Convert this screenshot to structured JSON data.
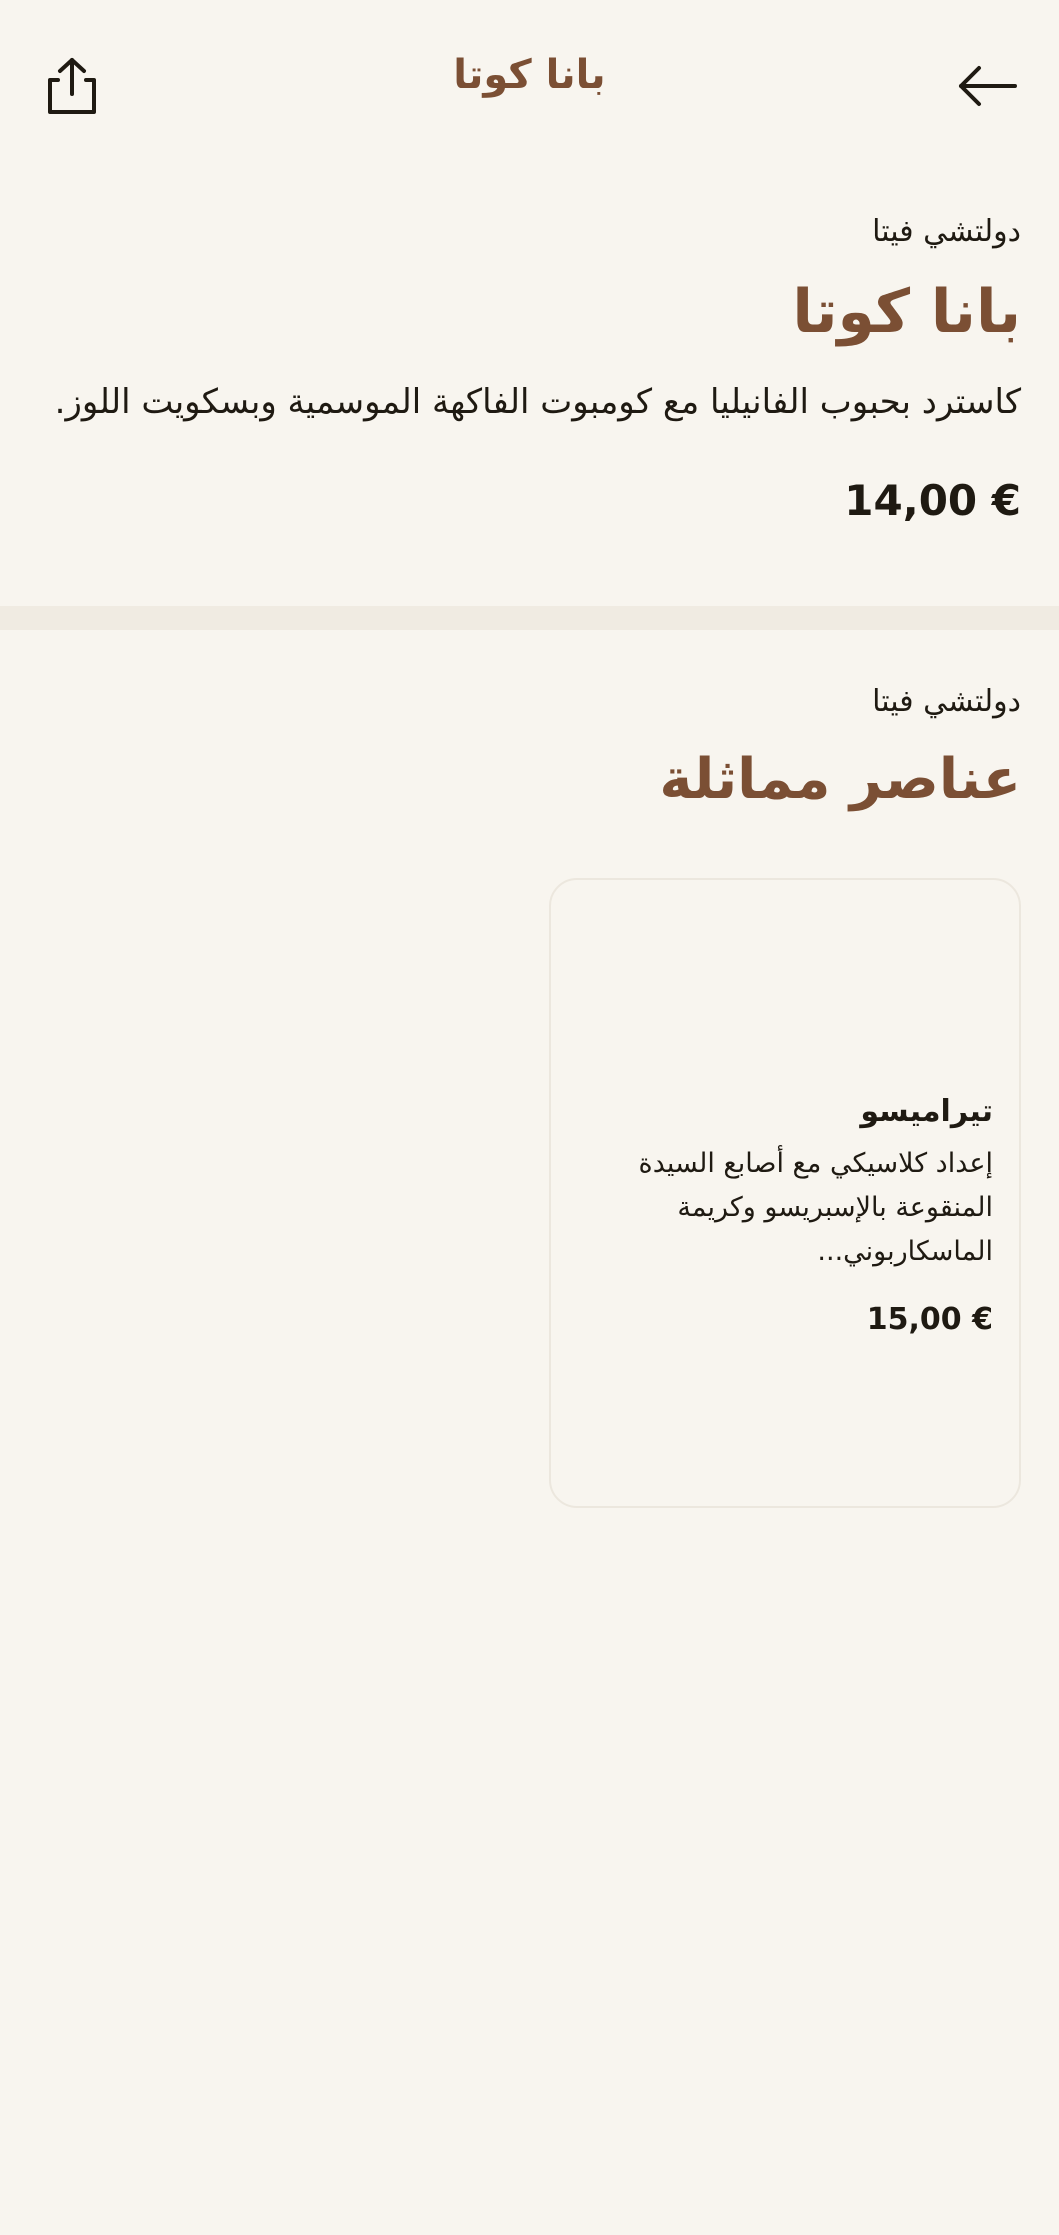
{
  "header": {
    "title": "بانا كوتا",
    "back_icon": "arrow-left-icon",
    "share_icon": "share-icon"
  },
  "product": {
    "category": "دولتشي فيتا",
    "title": "بانا كوتا",
    "description": "كاسترد بحبوب الفانيليا مع كومبوت الفاكهة الموسمية وبسكويت اللوز.",
    "price": "14,00 €"
  },
  "similar": {
    "category": "دولتشي فيتا",
    "title": "عناصر مماثلة",
    "items": [
      {
        "name": "تيراميسو",
        "description": "إعداد كلاسيكي مع أصابع السيدة المنقوعة بالإسبريسو وكريمة الماسكاربوني...",
        "price": "15,00 €"
      }
    ]
  },
  "colors": {
    "background": "#f8f5ef",
    "accent": "#7b4f34",
    "text": "#1f1a12",
    "divider": "#f0ebe2"
  }
}
